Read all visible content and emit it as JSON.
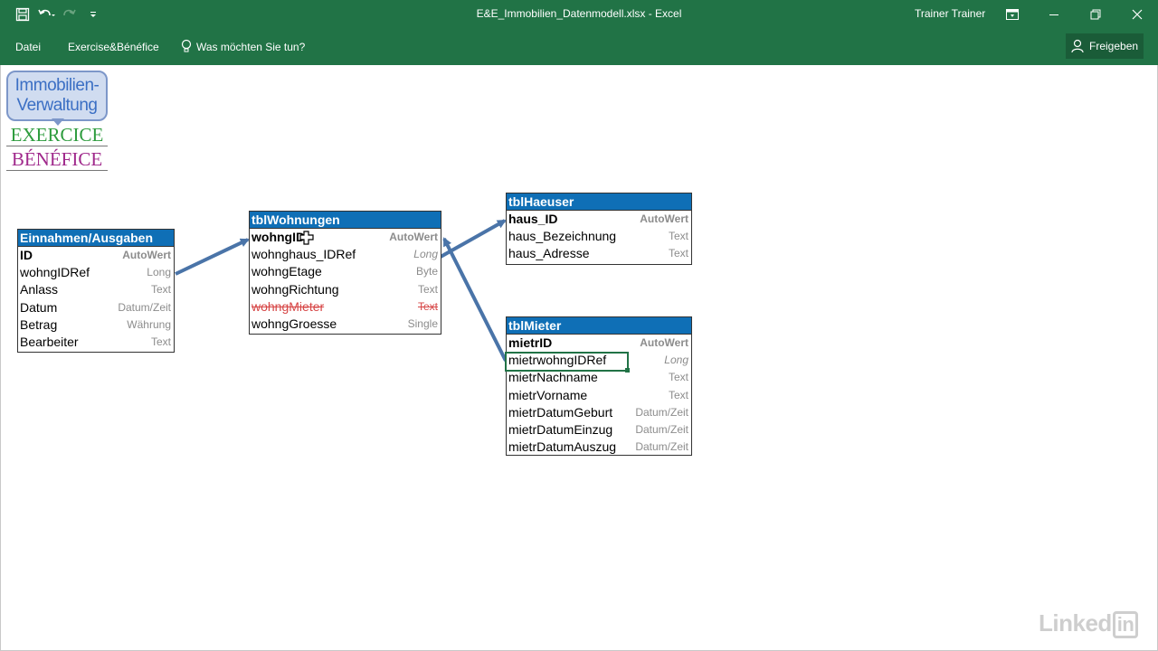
{
  "window": {
    "title": "E&E_Immobilien_Datenmodell.xlsx - Excel",
    "user": "Trainer Trainer"
  },
  "ribbon": {
    "tabs": [
      {
        "label": "Datei"
      },
      {
        "label": "Exercise&Bénéfice"
      }
    ],
    "tell_me": "Was möchten Sie tun?",
    "share": "Freigeben"
  },
  "logo": {
    "line1": "Immobilien-",
    "line2": "Verwaltung",
    "line3": "EXERCICE",
    "line4": "BÉNÉFICE"
  },
  "tables": {
    "einnahmen": {
      "name": "Einnahmen/Ausgaben",
      "fields": [
        {
          "name": "ID",
          "type": "AutoWert"
        },
        {
          "name": "wohngIDRef",
          "type": "Long"
        },
        {
          "name": "Anlass",
          "type": "Text"
        },
        {
          "name": "Datum",
          "type": "Datum/Zeit"
        },
        {
          "name": "Betrag",
          "type": "Währung"
        },
        {
          "name": "Bearbeiter",
          "type": "Text"
        }
      ]
    },
    "wohnungen": {
      "name": "tblWohnungen",
      "fields": [
        {
          "name": "wohngID",
          "type": "AutoWert"
        },
        {
          "name": "wohnghaus_IDRef",
          "type": "Long"
        },
        {
          "name": "wohngEtage",
          "type": "Byte"
        },
        {
          "name": "wohngRichtung",
          "type": "Text"
        },
        {
          "name": "wohngMieter",
          "type": "Text"
        },
        {
          "name": "wohngGroesse",
          "type": "Single"
        }
      ]
    },
    "haeuser": {
      "name": "tblHaeuser",
      "fields": [
        {
          "name": "haus_ID",
          "type": "AutoWert"
        },
        {
          "name": "haus_Bezeichnung",
          "type": "Text"
        },
        {
          "name": "haus_Adresse",
          "type": "Text"
        }
      ]
    },
    "mieter": {
      "name": "tblMieter",
      "fields": [
        {
          "name": "mietrID",
          "type": "AutoWert"
        },
        {
          "name": "mietrwohngIDRef",
          "type": "Long"
        },
        {
          "name": "mietrNachname",
          "type": "Text"
        },
        {
          "name": "mietrVorname",
          "type": "Text"
        },
        {
          "name": "mietrDatumGeburt",
          "type": "Datum/Zeit"
        },
        {
          "name": "mietrDatumEinzug",
          "type": "Datum/Zeit"
        },
        {
          "name": "mietrDatumAuszug",
          "type": "Datum/Zeit"
        }
      ]
    }
  },
  "watermark": {
    "brand": "Linked",
    "brand_box": "in"
  },
  "colors": {
    "excel_green": "#217346",
    "table_header": "#0f6fb6",
    "arrow": "#4a74a8",
    "struck": "#d64545"
  }
}
